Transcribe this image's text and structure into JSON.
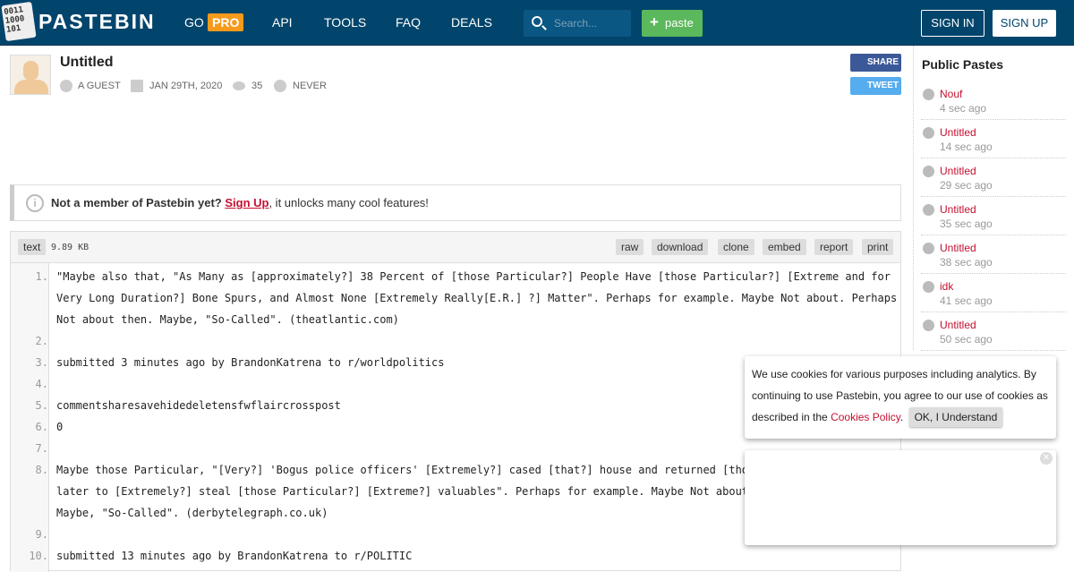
{
  "header": {
    "logo_text": "0011 1000 101",
    "brand": "PASTEBIN",
    "nav": [
      {
        "label": "GO"
      },
      {
        "label": "API"
      },
      {
        "label": "TOOLS"
      },
      {
        "label": "FAQ"
      },
      {
        "label": "DEALS"
      }
    ],
    "pro_badge": "PRO",
    "search_placeholder": "Search...",
    "paste_label": "paste",
    "sign_in": "SIGN IN",
    "sign_up": "SIGN UP",
    "colors": {
      "bar": "#02456c",
      "pro": "#f69a1c",
      "paste": "#5cb85c"
    }
  },
  "paste": {
    "title": "Untitled",
    "author": "A GUEST",
    "date": "JAN 29TH, 2020",
    "views": "35",
    "expires": "NEVER",
    "share": "SHARE",
    "tweet": "TWEET"
  },
  "notice": {
    "bold": "Not a member of Pastebin yet?",
    "link": "Sign Up",
    "rest": ", it unlocks many cool features!"
  },
  "code": {
    "syntax": "text",
    "size": "9.89 KB",
    "actions": [
      "raw",
      "download",
      "clone",
      "embed",
      "report",
      "print"
    ],
    "lines": [
      {
        "n": "1.",
        "rows": [
          "\"Maybe also that, \"As Many as [approximately?] 38 Percent of [those Particular?] People Have [those Particular?] [Extreme and for",
          "Very Long Duration?] Bone Spurs, and Almost None [Extremely Really[E.R.] ?] Matter\". Perhaps for example. Maybe Not about. Perhaps",
          "Not about then. Maybe, \"So-Called\". (theatlantic.com)"
        ]
      },
      {
        "n": "2.",
        "rows": [
          ""
        ]
      },
      {
        "n": "3.",
        "rows": [
          "submitted 3 minutes ago by BrandonKatrena to r/worldpolitics"
        ]
      },
      {
        "n": "4.",
        "rows": [
          ""
        ]
      },
      {
        "n": "5.",
        "rows": [
          "commentsharesavehidedeletensfwflaircrosspost"
        ]
      },
      {
        "n": "6.",
        "rows": [
          "0"
        ]
      },
      {
        "n": "7.",
        "rows": [
          ""
        ]
      },
      {
        "n": "8.",
        "rows": [
          "Maybe those Particular, \"[Very?] 'Bogus police officers' [Extremely?] cased [that?] house and returned [those",
          "later to [Extremely?] steal [those Particular?] [Extreme?] valuables\". Perhaps for example. Maybe Not about. P",
          "Maybe, \"So-Called\". (derbytelegraph.co.uk)"
        ]
      },
      {
        "n": "9.",
        "rows": [
          ""
        ]
      },
      {
        "n": "10.",
        "rows": [
          "submitted 13 minutes ago by BrandonKatrena to r/POLITIC"
        ]
      }
    ]
  },
  "sidebar": {
    "title": "Public Pastes",
    "items": [
      {
        "name": "Nouf",
        "time": "4 sec ago"
      },
      {
        "name": "Untitled",
        "time": "14 sec ago"
      },
      {
        "name": "Untitled",
        "time": "29 sec ago"
      },
      {
        "name": "Untitled",
        "time": "35 sec ago"
      },
      {
        "name": "Untitled",
        "time": "38 sec ago"
      },
      {
        "name": "idk",
        "time": "41 sec ago"
      },
      {
        "name": "Untitled",
        "time": "50 sec ago"
      }
    ]
  },
  "cookie": {
    "text": "We use cookies for various purposes including analytics. By continuing to use Pastebin, you agree to our use of cookies as described in the ",
    "link": "Cookies Policy",
    "after": ".",
    "ok": "OK, I Understand"
  }
}
